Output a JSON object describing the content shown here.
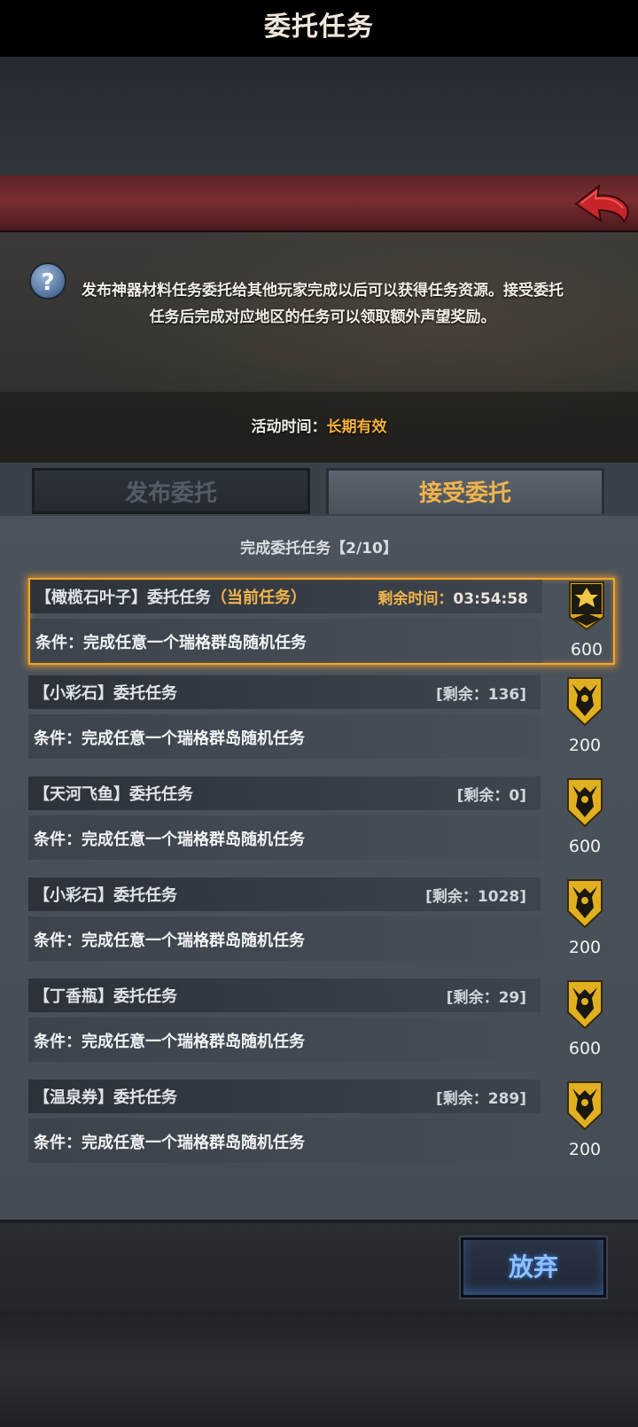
{
  "header": {
    "title": "委托任务"
  },
  "info": {
    "description": "发布神器材料任务委托给其他玩家完成以后可以获得任务资源。接受委托任务后完成对应地区的任务可以领取额外声望奖励。",
    "time_label": "活动时间：",
    "time_value": "长期有效"
  },
  "tabs": [
    {
      "label": "发布委托",
      "active": false
    },
    {
      "label": "接受委托",
      "active": true
    }
  ],
  "progress": "完成委托任务【2/10】",
  "tasks": [
    {
      "title": "【橄榄石叶子】委托任务",
      "current_tag": "（当前任务）",
      "timer_label": "剩余时间：",
      "timer_value": "03:54:58",
      "condition": "条件：完成任意一个瑞格群岛随机任务",
      "reward": "600",
      "icon": "gold-cross-shield-icon"
    },
    {
      "title": "【小彩石】委托任务",
      "remaining": "[剩余：136]",
      "condition": "条件：完成任意一个瑞格群岛随机任务",
      "reward": "200",
      "icon": "gold-crest-shield-icon"
    },
    {
      "title": "【天河飞鱼】委托任务",
      "remaining": "[剩余：0]",
      "condition": "条件：完成任意一个瑞格群岛随机任务",
      "reward": "600",
      "icon": "gold-crest-shield-icon"
    },
    {
      "title": "【小彩石】委托任务",
      "remaining": "[剩余：1028]",
      "condition": "条件：完成任意一个瑞格群岛随机任务",
      "reward": "200",
      "icon": "gold-crest-shield-icon"
    },
    {
      "title": "【丁香瓶】委托任务",
      "remaining": "[剩余：29]",
      "condition": "条件：完成任意一个瑞格群岛随机任务",
      "reward": "600",
      "icon": "gold-crest-shield-icon"
    },
    {
      "title": "【温泉券】委托任务",
      "remaining": "[剩余：289]",
      "condition": "条件：完成任意一个瑞格群岛随机任务",
      "reward": "200",
      "icon": "gold-crest-shield-icon"
    }
  ],
  "footer": {
    "abandon_label": "放弃"
  },
  "colors": {
    "accent": "#f1b54a",
    "highlight": "#f4a62a",
    "button_text": "#8fc0ff"
  }
}
